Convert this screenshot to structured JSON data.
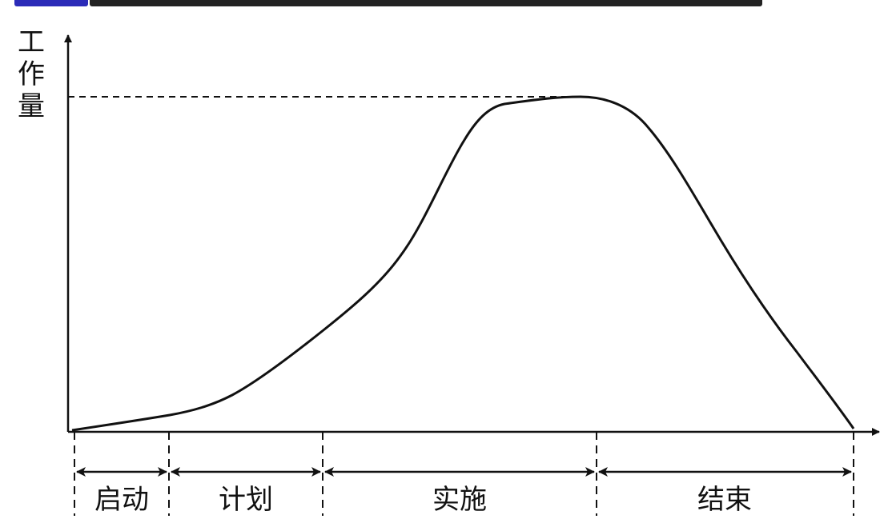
{
  "y_axis_label": [
    "工",
    "作",
    "量"
  ],
  "phases": [
    {
      "label": "启动"
    },
    {
      "label": "计划"
    },
    {
      "label": "实施"
    },
    {
      "label": "结束"
    }
  ],
  "colors": {
    "line": "#111111",
    "header_accent": "#2b2bb8"
  }
}
